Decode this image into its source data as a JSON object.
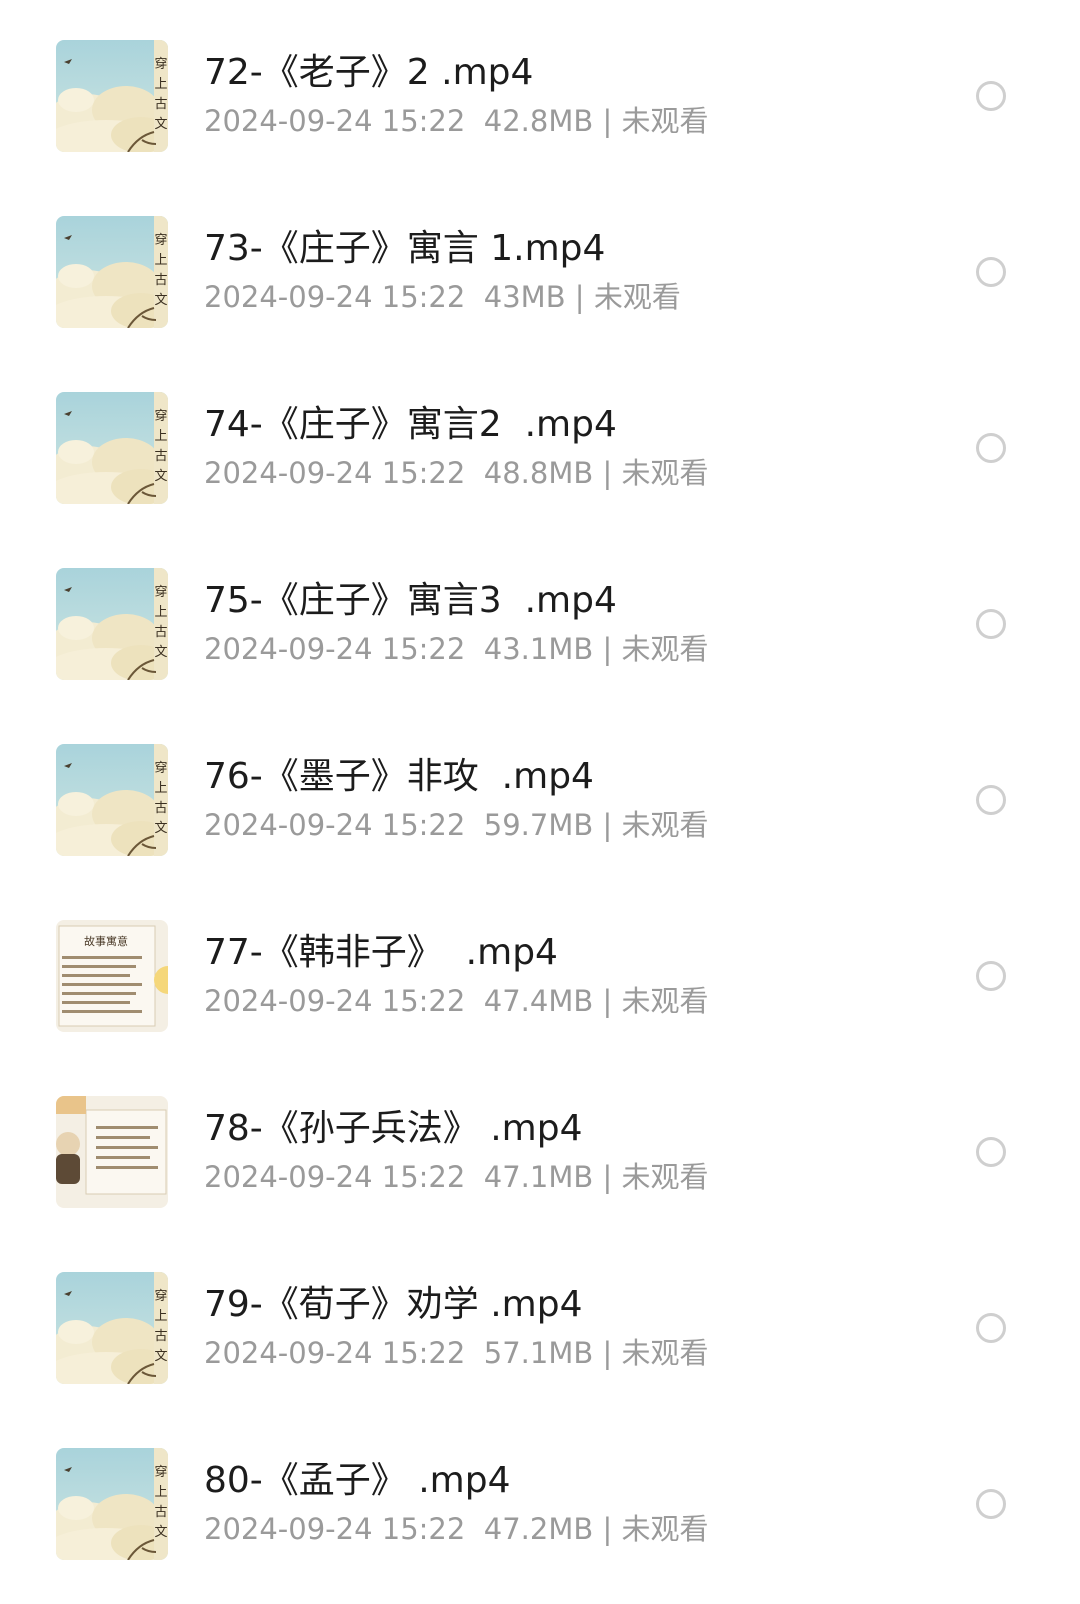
{
  "files": [
    {
      "title": "72-《老子》2 .mp4",
      "date": "2024-09-24 15:22",
      "size": "42.8MB",
      "status": "未观看",
      "thumbnail": "landscape"
    },
    {
      "title": "73-《庄子》寓言 1.mp4",
      "date": "2024-09-24 15:22",
      "size": "43MB",
      "status": "未观看",
      "thumbnail": "landscape"
    },
    {
      "title": "74-《庄子》寓言2  .mp4",
      "date": "2024-09-24 15:22",
      "size": "48.8MB",
      "status": "未观看",
      "thumbnail": "landscape"
    },
    {
      "title": "75-《庄子》寓言3  .mp4",
      "date": "2024-09-24 15:22",
      "size": "43.1MB",
      "status": "未观看",
      "thumbnail": "landscape"
    },
    {
      "title": "76-《墨子》非攻  .mp4",
      "date": "2024-09-24 15:22",
      "size": "59.7MB",
      "status": "未观看",
      "thumbnail": "landscape"
    },
    {
      "title": "77-《韩非子》  .mp4",
      "date": "2024-09-24 15:22",
      "size": "47.4MB",
      "status": "未观看",
      "thumbnail": "text-page"
    },
    {
      "title": "78-《孙子兵法》 .mp4",
      "date": "2024-09-24 15:22",
      "size": "47.1MB",
      "status": "未观看",
      "thumbnail": "portrait-page"
    },
    {
      "title": "79-《荀子》劝学 .mp4",
      "date": "2024-09-24 15:22",
      "size": "57.1MB",
      "status": "未观看",
      "thumbnail": "landscape"
    },
    {
      "title": "80-《孟子》 .mp4",
      "date": "2024-09-24 15:22",
      "size": "47.2MB",
      "status": "未观看",
      "thumbnail": "landscape"
    }
  ],
  "colors": {
    "title": "#1c1c1c",
    "meta": "#9a9a9a",
    "radio_border": "#cfcfcf",
    "sky": "#b9dbe0",
    "cloud": "#f1ead0"
  }
}
